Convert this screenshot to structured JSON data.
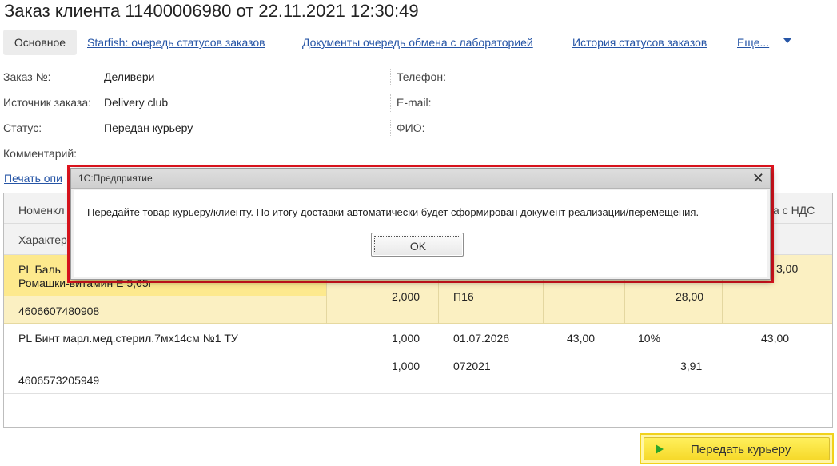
{
  "window": {
    "title": "Заказ клиента 11400006980 от 22.11.2021 12:30:49"
  },
  "tabs": {
    "main": "Основное",
    "links": [
      "Starfish: очередь статусов заказов",
      "Документы очередь обмена с лабораторией",
      "История статусов заказов",
      "Еще..."
    ]
  },
  "fields": {
    "left": [
      {
        "label": "Заказ №:",
        "value": "Деливери"
      },
      {
        "label": "Источник заказа:",
        "value": "Delivery club"
      },
      {
        "label": "Статус:",
        "value": "Передан курьеру"
      },
      {
        "label": "Комментарий:",
        "value": ""
      }
    ],
    "right": [
      {
        "label": "Телефон:"
      },
      {
        "label": "E-mail:"
      },
      {
        "label": "ФИО:"
      }
    ]
  },
  "print_link": "Печать опи",
  "table": {
    "header_row1_left": "Номенкл",
    "header_row1_right": "а с НДС",
    "header_row2_left": "Характер",
    "rows": [
      {
        "name_line1": "PL Баль",
        "name_line2": "Ромашки-витамин Е 5,65г",
        "top_right": "3,00",
        "qty": "2,000",
        "series": "П16",
        "amount2": "28,00",
        "barcode": "4606607480908"
      },
      {
        "name": "PL Бинт марл.мед.стерил.7мх14см №1 ТУ",
        "qty1": "1,000",
        "date": "01.07.2026",
        "price": "43,00",
        "vat": "10%",
        "total": "43,00",
        "qty2": "1,000",
        "series": "072021",
        "amount2": "3,91",
        "barcode": "4606573205949"
      }
    ]
  },
  "action_button": {
    "label": "Передать курьеру",
    "icon": "play-icon"
  },
  "dialog": {
    "title": "1С:Предприятие",
    "message": "Передайте товар курьеру/клиенту. По итогу доставки автоматически будет сформирован документ реализации/перемещения.",
    "ok_label": "OK",
    "close_icon": "close-icon"
  },
  "colors": {
    "link": "#2655a6",
    "selected_row": "#fbf0c2",
    "highlight_frame": "#e0141e",
    "action_button": "#f6d92a"
  }
}
